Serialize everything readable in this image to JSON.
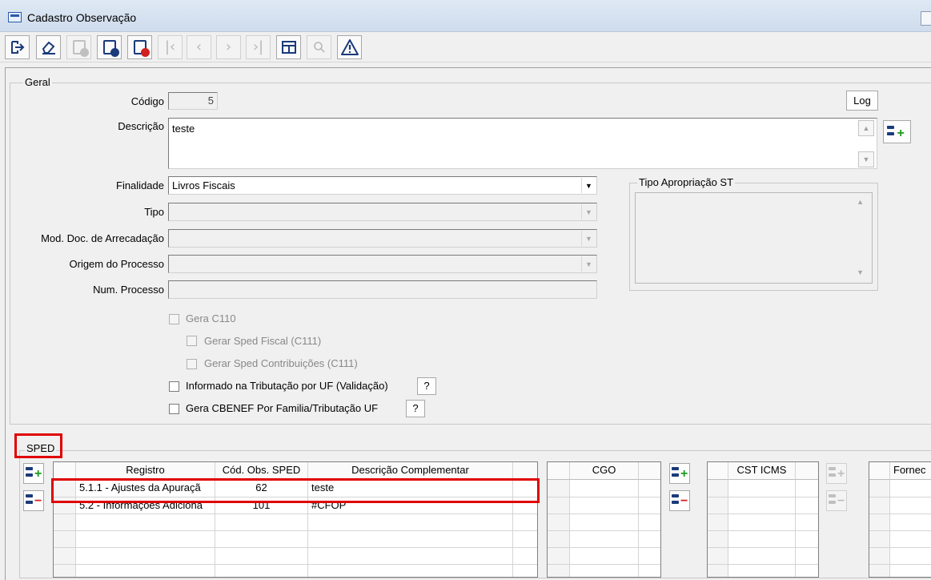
{
  "window": {
    "title": "Cadastro Observação"
  },
  "toolbar": {
    "buttons": [
      {
        "name": "exit-icon",
        "glyph": "⇨"
      },
      {
        "name": "eraser-icon",
        "glyph": "✎"
      },
      {
        "name": "add-record-icon"
      },
      {
        "name": "save-icon",
        "badge": "#1a3a7a"
      },
      {
        "name": "delete-icon",
        "badge": "#d41f1f"
      },
      {
        "name": "first-record-icon",
        "glyph": "|<"
      },
      {
        "name": "previous-record-icon",
        "glyph": "<"
      },
      {
        "name": "next-record-icon",
        "glyph": ">"
      },
      {
        "name": "last-record-icon",
        "glyph": ">|"
      },
      {
        "name": "grid-view-icon",
        "glyph": "▦"
      },
      {
        "name": "search-icon",
        "glyph": "🔍"
      },
      {
        "name": "warning-icon",
        "glyph": "⚠"
      }
    ]
  },
  "geral": {
    "legend": "Geral",
    "codigo_label": "Código",
    "codigo_value": "5",
    "log_label": "Log",
    "descricao_label": "Descrição",
    "descricao_value": "teste",
    "finalidade_label": "Finalidade",
    "finalidade_value": "Livros Fiscais",
    "tipo_label": "Tipo",
    "mod_doc_label": "Mod. Doc. de Arrecadação",
    "origem_label": "Origem do Processo",
    "num_processo_label": "Num. Processo",
    "tipo_apropriacao_legend": "Tipo Apropriação ST",
    "checkboxes": {
      "gera_c110": "Gera C110",
      "sped_fiscal": "Gerar Sped Fiscal (C111)",
      "sped_contrib": "Gerar Sped Contribuições (C111)",
      "informado_uf": "Informado na Tributação por UF (Validação)",
      "gera_cbenef": "Gera CBENEF Por Familia/Tributação UF"
    },
    "help_label": "?"
  },
  "sped": {
    "legend": "SPED",
    "columns": [
      "Registro",
      "Cód. Obs. SPED",
      "Descrição Complementar"
    ],
    "rows": [
      {
        "registro": "5.1.1 - Ajustes da Apuraçã",
        "cod": "62",
        "desc": "teste"
      },
      {
        "registro": "5.2 - Informações Adiciona",
        "cod": "101",
        "desc": "#CFOP"
      }
    ],
    "cgo_header": "CGO",
    "cst_header": "CST ICMS",
    "fornec_header": "Fornec"
  },
  "colors": {
    "highlight": "#e00000",
    "icon": "#1a3a7a",
    "add": "#1b9a1b",
    "remove": "#d41f1f"
  }
}
